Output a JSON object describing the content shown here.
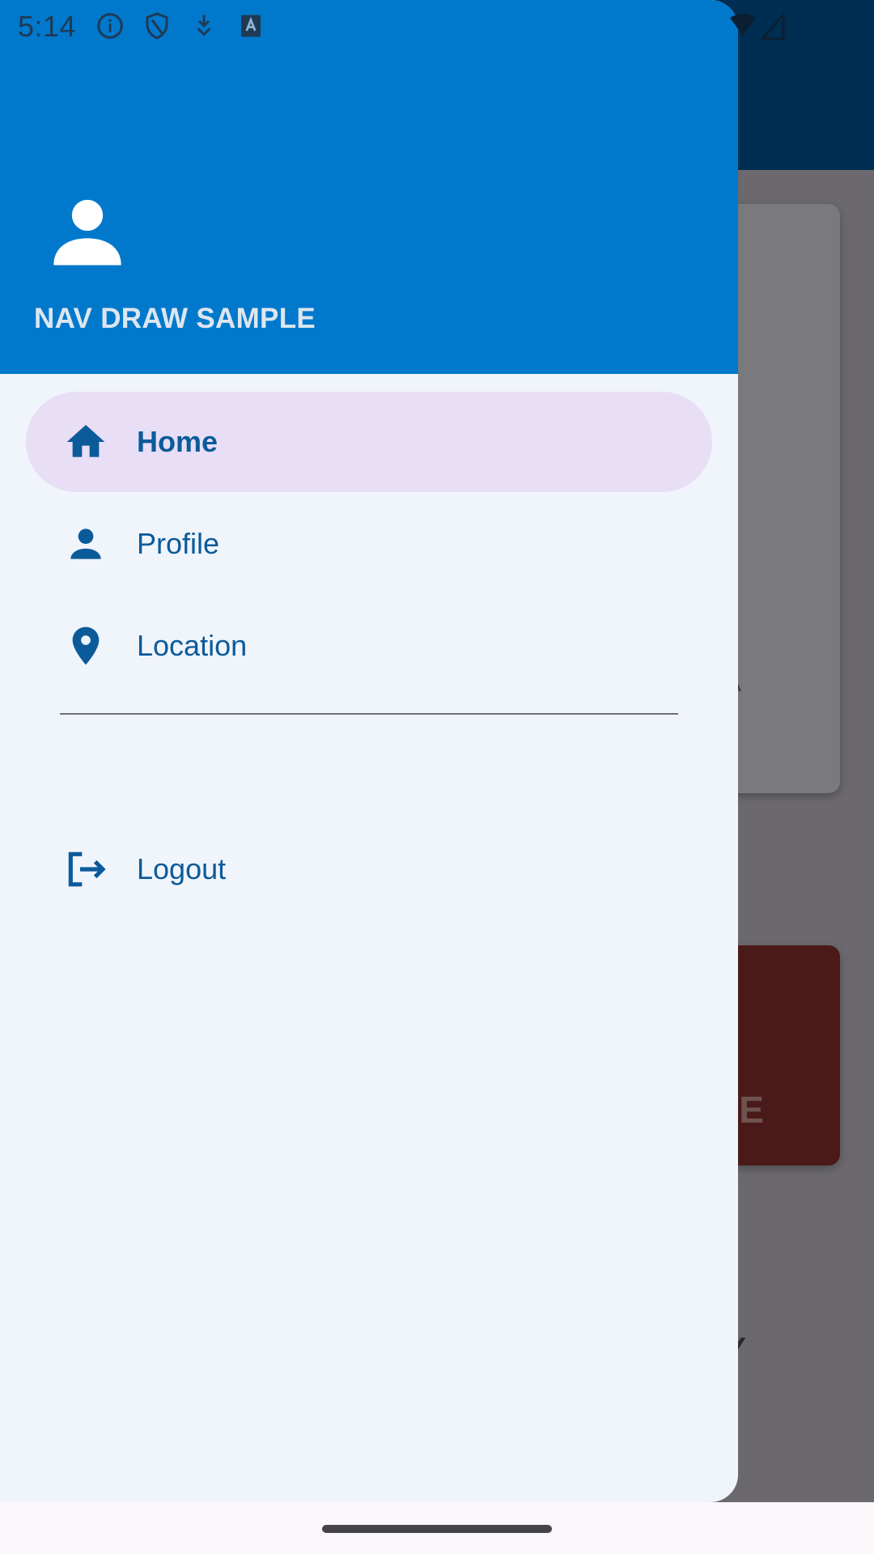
{
  "status_bar": {
    "time": "5:14"
  },
  "drawer": {
    "header_title": "NAV DRAW SAMPLE",
    "items": [
      {
        "label": "Home",
        "icon": "home-icon",
        "active": true
      },
      {
        "label": "Profile",
        "icon": "person-icon",
        "active": false
      },
      {
        "label": "Location",
        "icon": "location-pin-icon",
        "active": false
      }
    ],
    "footer_item": {
      "label": "Logout",
      "icon": "logout-icon"
    }
  },
  "background_app": {
    "card_text": "A",
    "button_text": "CE",
    "bottom_text": "Y"
  },
  "colors": {
    "drawer_header": "#0079cc",
    "drawer_background": "#f0f4fb",
    "active_item": "#e8def6",
    "item_text": "#0b5b9a",
    "scrim": "#6b696d"
  }
}
